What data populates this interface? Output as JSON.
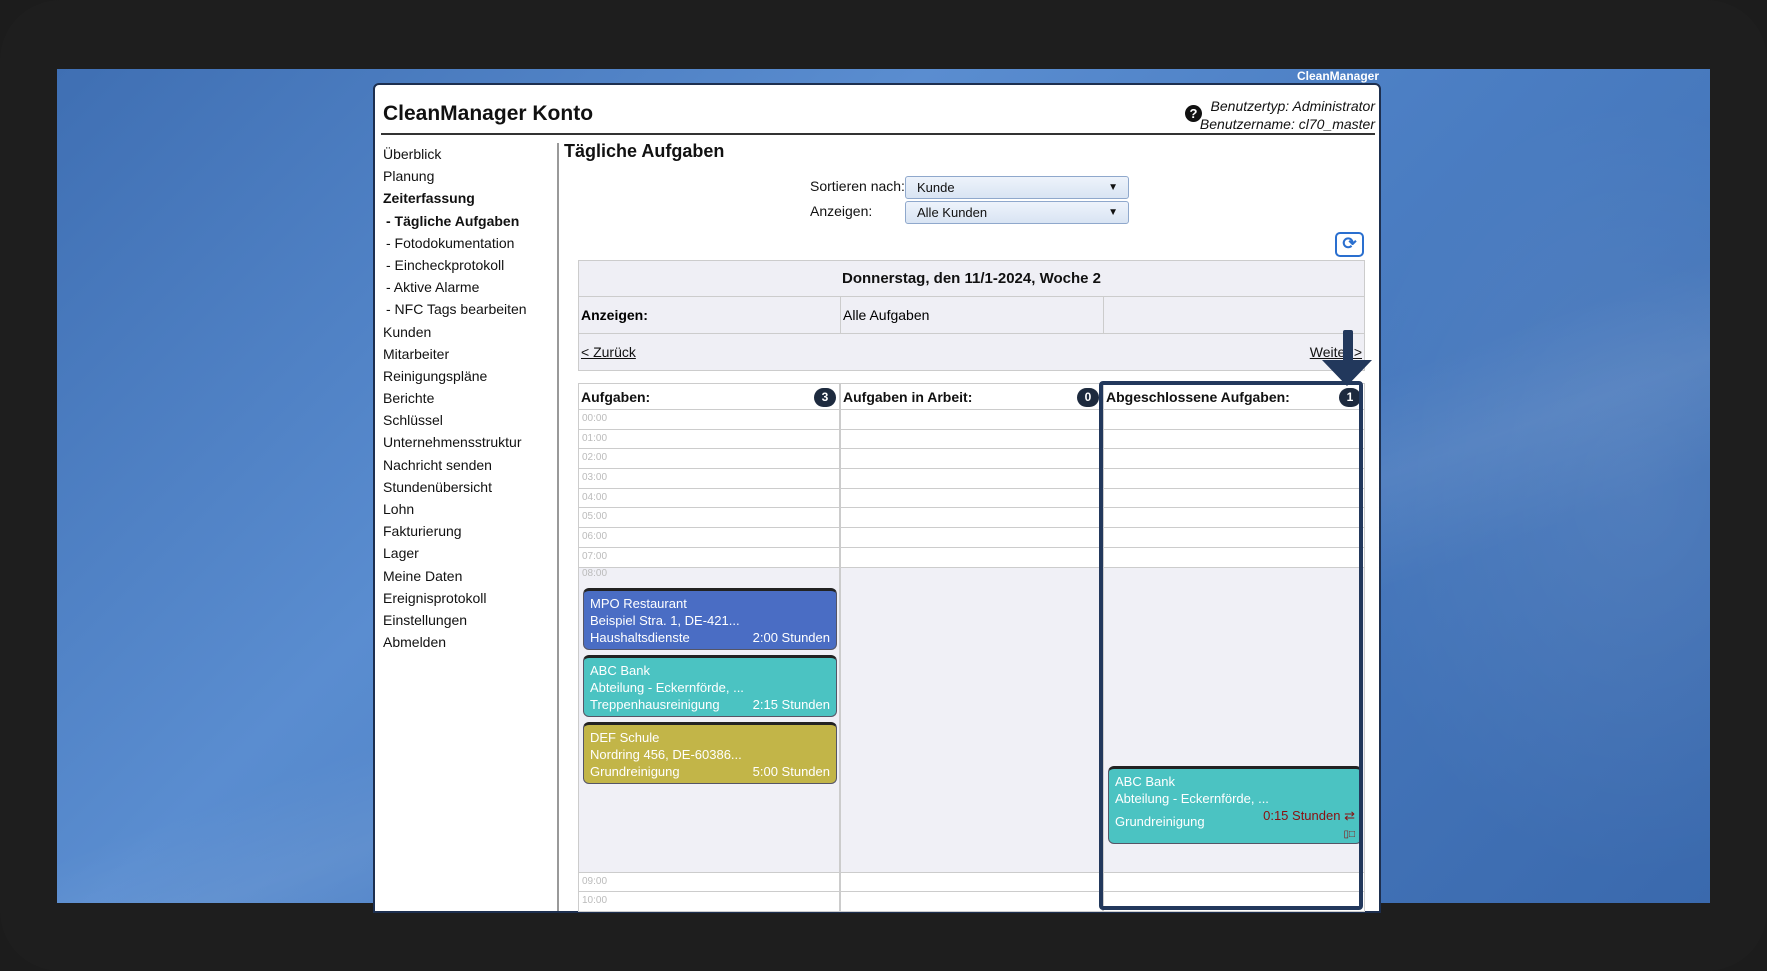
{
  "brand": "CleanManager",
  "header": {
    "title": "CleanManager Konto",
    "user_type": "Benutzertyp: Administrator",
    "user_name": "Benutzername: cl70_master",
    "help_icon": "question-circle-icon"
  },
  "sidebar": {
    "items": [
      {
        "label": "Überblick"
      },
      {
        "label": "Planung"
      },
      {
        "label": "Zeiterfassung",
        "bold": true
      },
      {
        "label": "- Tägliche Aufgaben",
        "bold": true
      },
      {
        "label": "- Fotodokumentation"
      },
      {
        "label": "- Eincheckprotokoll"
      },
      {
        "label": "- Aktive Alarme"
      },
      {
        "label": "- NFC Tags bearbeiten"
      },
      {
        "label": "Kunden"
      },
      {
        "label": "Mitarbeiter"
      },
      {
        "label": "Reinigungspläne"
      },
      {
        "label": "Berichte"
      },
      {
        "label": "Schlüssel"
      },
      {
        "label": "Unternehmensstruktur"
      },
      {
        "label": "Nachricht senden"
      },
      {
        "label": "Stundenübersicht"
      },
      {
        "label": "Lohn"
      },
      {
        "label": "Fakturierung"
      },
      {
        "label": "Lager"
      },
      {
        "label": "Meine Daten"
      },
      {
        "label": "Ereignisprotokoll"
      },
      {
        "label": "Einstellungen"
      },
      {
        "label": "Abmelden"
      }
    ]
  },
  "main": {
    "title": "Tägliche Aufgaben",
    "sort_label": "Sortieren nach:",
    "sort_value": "Kunde",
    "show_label": "Anzeigen:",
    "show_value": "Alle Kunden",
    "date_header": "Donnerstag, den 11/1-2024, Woche 2",
    "filter_label": "Anzeigen:",
    "filter_value": "Alle Aufgaben",
    "back": "< Zurück",
    "next": "Weiter >",
    "hours": [
      "00:00",
      "01:00",
      "02:00",
      "03:00",
      "04:00",
      "05:00",
      "06:00",
      "07:00",
      "08:00",
      "09:00",
      "10:00"
    ],
    "columns": [
      {
        "title": "Aufgaben:",
        "count": "3",
        "cards": [
          {
            "name": "MPO Restaurant",
            "address": "Beispiel Stra. 1, DE-421...",
            "service": "Haushaltsdienste",
            "duration": "2:00 Stunden",
            "color": "#4a6dc4"
          },
          {
            "name": "ABC Bank",
            "address": "Abteilung - Eckernförde, ...",
            "service": "Treppenhausreinigung",
            "duration": "2:15 Stunden",
            "color": "#4bc3c2"
          },
          {
            "name": "DEF Schule",
            "address": "Nordring 456, DE-60386...",
            "service": "Grundreinigung",
            "duration": "5:00 Stunden",
            "color": "#c2b548"
          }
        ]
      },
      {
        "title": "Aufgaben in Arbeit:",
        "count": "0",
        "cards": []
      },
      {
        "title": "Abgeschlossene Aufgaben:",
        "count": "1",
        "cards": [
          {
            "name": "ABC Bank",
            "address": "Abteilung - Eckernförde, ...",
            "service": "Grundreinigung",
            "duration": "0:15 Stunden",
            "color": "#4bc3c2",
            "duration_color": "#8b1010"
          }
        ]
      }
    ]
  },
  "colors": {
    "highlight": "#22385c",
    "badge": "#1d2a3e"
  }
}
